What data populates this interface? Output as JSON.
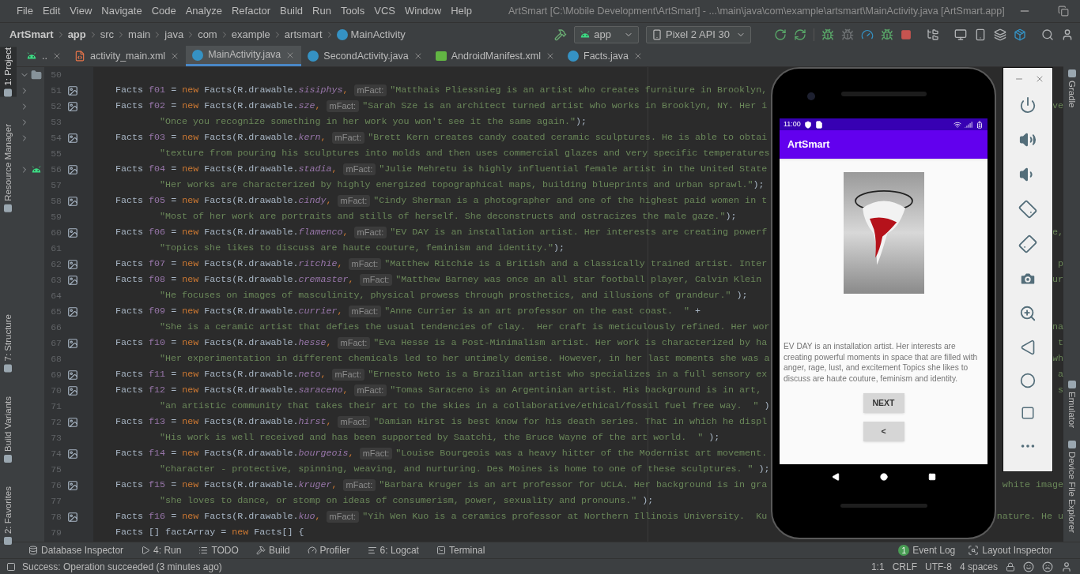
{
  "menu_bar": {
    "items": [
      "File",
      "Edit",
      "View",
      "Navigate",
      "Code",
      "Analyze",
      "Refactor",
      "Build",
      "Run",
      "Tools",
      "VCS",
      "Window",
      "Help"
    ],
    "title": "ArtSmart [C:\\Mobile Development\\ArtSmart] - ...\\main\\java\\com\\example\\artsmart\\MainActivity.java [ArtSmart.app]"
  },
  "nav_bar": {
    "breadcrumbs": [
      {
        "label": "ArtSmart",
        "bold": true
      },
      {
        "label": "app",
        "bold": true
      },
      {
        "label": "src",
        "bold": false
      },
      {
        "label": "main",
        "bold": false
      },
      {
        "label": "java",
        "bold": false
      },
      {
        "label": "com",
        "bold": false
      },
      {
        "label": "example",
        "bold": false
      },
      {
        "label": "artsmart",
        "bold": false
      },
      {
        "label": "MainActivity",
        "bold": false,
        "kind": "class"
      }
    ],
    "run_config": "app",
    "device": "Pixel 2 API 30"
  },
  "left_strip": [
    {
      "label": "1: Project",
      "selected": true
    },
    {
      "label": "Resource Manager",
      "selected": false
    },
    {
      "label": "7: Structure",
      "selected": false
    },
    {
      "label": "Build Variants",
      "selected": false
    },
    {
      "label": "2: Favorites",
      "selected": false
    }
  ],
  "right_strip": [
    "Gradle",
    "Emulator",
    "Device File Explorer"
  ],
  "tabs": [
    {
      "label": "..",
      "kind": "android",
      "selected": false
    },
    {
      "label": "activity_main.xml",
      "kind": "xml",
      "selected": false
    },
    {
      "label": "MainActivity.java",
      "kind": "class",
      "selected": true
    },
    {
      "label": "SecondActivity.java",
      "kind": "class",
      "selected": false
    },
    {
      "label": "AndroidManifest.xml",
      "kind": "manifest",
      "selected": false
    },
    {
      "label": "Facts.java",
      "kind": "class",
      "selected": false
    }
  ],
  "project_tree": [
    {
      "kind": "folder",
      "expanded": true
    },
    {
      "kind": "node",
      "expanded": false
    },
    {
      "kind": "node",
      "expanded": false
    },
    {
      "kind": "node",
      "expanded": false
    },
    {
      "kind": "node",
      "expanded": false
    },
    {
      "kind": "module",
      "expanded": false
    }
  ],
  "code_lines": [
    {
      "number": "50",
      "kind": "blank"
    },
    {
      "number": "51",
      "kind": "decl",
      "parts": [
        {
          "kind": "plain",
          "text": "Facts "
        },
        {
          "kind": "var",
          "text": "f01"
        },
        {
          "kind": "plain",
          "text": " = "
        },
        {
          "kind": "keyword",
          "text": "new"
        },
        {
          "kind": "plain",
          "text": " Facts(R.drawable."
        },
        {
          "kind": "field",
          "text": "sisiphys"
        },
        {
          "kind": "keyword",
          "text": ","
        }
      ],
      "hint": "mFact:",
      "after": [
        {
          "kind": "string",
          "text": "\"Matthais Pliessnieg is an artist who creates furniture in Brooklyn,"
        }
      ]
    },
    {
      "number": "52",
      "kind": "decl",
      "parts": [
        {
          "kind": "plain",
          "text": "Facts "
        },
        {
          "kind": "var",
          "text": "f02"
        },
        {
          "kind": "plain",
          "text": " = "
        },
        {
          "kind": "keyword",
          "text": "new"
        },
        {
          "kind": "plain",
          "text": " Facts(R.drawable."
        },
        {
          "kind": "field",
          "text": "sze"
        },
        {
          "kind": "keyword",
          "text": ","
        }
      ],
      "hint": "mFact:",
      "after": [
        {
          "kind": "string",
          "text": "\"Sarah Sze is an architect turned artist who works in Brooklyn, NY. Her i"
        }
      ],
      "tail": "ve"
    },
    {
      "number": "53",
      "kind": "continuation",
      "parts": [
        {
          "kind": "string",
          "text": "\"Once you recognize something in her work you won't see it the same again.\""
        },
        {
          "kind": "plain",
          "text": ");"
        }
      ]
    },
    {
      "number": "54",
      "kind": "decl",
      "parts": [
        {
          "kind": "plain",
          "text": "Facts "
        },
        {
          "kind": "var",
          "text": "f03"
        },
        {
          "kind": "plain",
          "text": " = "
        },
        {
          "kind": "keyword",
          "text": "new"
        },
        {
          "kind": "plain",
          "text": " Facts(R.drawable."
        },
        {
          "kind": "field",
          "text": "kern"
        },
        {
          "kind": "keyword",
          "text": ","
        }
      ],
      "hint": "mFact:",
      "after": [
        {
          "kind": "string",
          "text": "\"Brett Kern creates candy coated ceramic sculptures. He is able to obtai"
        }
      ]
    },
    {
      "number": "55",
      "kind": "continuation",
      "parts": [
        {
          "kind": "string",
          "text": "\"texture from pouring his sculptures into molds and then uses commercial glazes and very specific temperatures"
        }
      ]
    },
    {
      "number": "56",
      "kind": "decl",
      "parts": [
        {
          "kind": "plain",
          "text": "Facts "
        },
        {
          "kind": "var",
          "text": "f04"
        },
        {
          "kind": "plain",
          "text": " = "
        },
        {
          "kind": "keyword",
          "text": "new"
        },
        {
          "kind": "plain",
          "text": " Facts(R.drawable."
        },
        {
          "kind": "field",
          "text": "stadia"
        },
        {
          "kind": "keyword",
          "text": ","
        }
      ],
      "hint": "mFact:",
      "after": [
        {
          "kind": "string",
          "text": "\"Julie Mehretu is highly influential female artist in the United State"
        }
      ]
    },
    {
      "number": "57",
      "kind": "continuation",
      "parts": [
        {
          "kind": "string",
          "text": "\"Her works are characterized by highly energized topographical maps, building blueprints and urban sprawl.\""
        },
        {
          "kind": "plain",
          "text": ");"
        }
      ]
    },
    {
      "number": "58",
      "kind": "decl",
      "parts": [
        {
          "kind": "plain",
          "text": "Facts "
        },
        {
          "kind": "var",
          "text": "f05"
        },
        {
          "kind": "plain",
          "text": " = "
        },
        {
          "kind": "keyword",
          "text": "new"
        },
        {
          "kind": "plain",
          "text": " Facts(R.drawable."
        },
        {
          "kind": "field",
          "text": "cindy"
        },
        {
          "kind": "keyword",
          "text": ","
        }
      ],
      "hint": "mFact:",
      "after": [
        {
          "kind": "string",
          "text": "\"Cindy Sherman is a photographer and one of the highest paid women in t"
        }
      ]
    },
    {
      "number": "59",
      "kind": "continuation",
      "parts": [
        {
          "kind": "string",
          "text": "\"Most of her work are portraits and stills of herself. She deconstructs and ostracizes the male gaze.\""
        },
        {
          "kind": "plain",
          "text": ");"
        }
      ]
    },
    {
      "number": "60",
      "kind": "decl",
      "parts": [
        {
          "kind": "plain",
          "text": "Facts "
        },
        {
          "kind": "var",
          "text": "f06"
        },
        {
          "kind": "plain",
          "text": " = "
        },
        {
          "kind": "keyword",
          "text": "new"
        },
        {
          "kind": "plain",
          "text": " Facts(R.drawable."
        },
        {
          "kind": "field",
          "text": "flamenco"
        },
        {
          "kind": "keyword",
          "text": ","
        }
      ],
      "hint": "mFact:",
      "after": [
        {
          "kind": "string",
          "text": "\"EV DAY is an installation artist. Her interests are creating powerf"
        }
      ],
      "tail": "e,"
    },
    {
      "number": "61",
      "kind": "continuation",
      "parts": [
        {
          "kind": "string",
          "text": "\"Topics she likes to discuss are haute couture, feminism and identity.\""
        },
        {
          "kind": "plain",
          "text": ");"
        }
      ]
    },
    {
      "number": "62",
      "kind": "decl",
      "parts": [
        {
          "kind": "plain",
          "text": "Facts "
        },
        {
          "kind": "var",
          "text": "f07"
        },
        {
          "kind": "plain",
          "text": " = "
        },
        {
          "kind": "keyword",
          "text": "new"
        },
        {
          "kind": "plain",
          "text": " Facts(R.drawable."
        },
        {
          "kind": "field",
          "text": "ritchie"
        },
        {
          "kind": "keyword",
          "text": ","
        }
      ],
      "hint": "mFact:",
      "after": [
        {
          "kind": "string",
          "text": "\"Matthew Ritchie is a British and a classically trained artist. Inter"
        }
      ],
      "tail": "p"
    },
    {
      "number": "63",
      "kind": "decl",
      "parts": [
        {
          "kind": "plain",
          "text": "Facts "
        },
        {
          "kind": "var",
          "text": "f08"
        },
        {
          "kind": "plain",
          "text": " = "
        },
        {
          "kind": "keyword",
          "text": "new"
        },
        {
          "kind": "plain",
          "text": " Facts(R.drawable."
        },
        {
          "kind": "field",
          "text": "cremaster"
        },
        {
          "kind": "keyword",
          "text": ","
        }
      ],
      "hint": "mFact:",
      "after": [
        {
          "kind": "string",
          "text": "\"Matthew Barney was once an all star football player, Calvin Klein"
        }
      ],
      "tail": "ur"
    },
    {
      "number": "64",
      "kind": "continuation",
      "parts": [
        {
          "kind": "string",
          "text": "\"He focuses on images of masculinity, physical prowess through prosthetics, and illusions of grandeur.\""
        },
        {
          "kind": "plain",
          "text": " );"
        }
      ]
    },
    {
      "number": "65",
      "kind": "decl",
      "parts": [
        {
          "kind": "plain",
          "text": "Facts "
        },
        {
          "kind": "var",
          "text": "f09"
        },
        {
          "kind": "plain",
          "text": " = "
        },
        {
          "kind": "keyword",
          "text": "new"
        },
        {
          "kind": "plain",
          "text": " Facts(R.drawable."
        },
        {
          "kind": "field",
          "text": "currier"
        },
        {
          "kind": "keyword",
          "text": ","
        }
      ],
      "hint": "mFact:",
      "after": [
        {
          "kind": "string",
          "text": "\"Anne Currier is an art professor on the east coast.  \""
        },
        {
          "kind": "plain",
          "text": " +"
        }
      ]
    },
    {
      "number": "66",
      "kind": "continuation",
      "parts": [
        {
          "kind": "string",
          "text": "\"She is a ceramic artist that defies the usual tendencies of clay.  Her craft is meticulously refined. Her wor"
        }
      ],
      "tail": "na"
    },
    {
      "number": "67",
      "kind": "decl",
      "parts": [
        {
          "kind": "plain",
          "text": "Facts "
        },
        {
          "kind": "var",
          "text": "f10"
        },
        {
          "kind": "plain",
          "text": " = "
        },
        {
          "kind": "keyword",
          "text": "new"
        },
        {
          "kind": "plain",
          "text": " Facts(R.drawable."
        },
        {
          "kind": "field",
          "text": "hesse"
        },
        {
          "kind": "keyword",
          "text": ","
        }
      ],
      "hint": "mFact:",
      "after": [
        {
          "kind": "string",
          "text": "\"Eva Hesse is a Post-Minimalism artist. Her work is characterized by ha"
        }
      ],
      "tail": "t"
    },
    {
      "number": "68",
      "kind": "continuation",
      "parts": [
        {
          "kind": "string",
          "text": "\"Her experimentation in different chemicals led to her untimely demise. However, in her last moments she was a"
        }
      ],
      "tail": "wh"
    },
    {
      "number": "69",
      "kind": "decl",
      "parts": [
        {
          "kind": "plain",
          "text": "Facts "
        },
        {
          "kind": "var",
          "text": "f11"
        },
        {
          "kind": "plain",
          "text": " = "
        },
        {
          "kind": "keyword",
          "text": "new"
        },
        {
          "kind": "plain",
          "text": " Facts(R.drawable."
        },
        {
          "kind": "field",
          "text": "neto"
        },
        {
          "kind": "keyword",
          "text": ","
        }
      ],
      "hint": "mFact:",
      "after": [
        {
          "kind": "string",
          "text": "\"Ernesto Neto is a Brazilian artist who specializes in a full sensory ex"
        }
      ],
      "tail": "a"
    },
    {
      "number": "70",
      "kind": "decl",
      "parts": [
        {
          "kind": "plain",
          "text": "Facts "
        },
        {
          "kind": "var",
          "text": "f12"
        },
        {
          "kind": "plain",
          "text": " = "
        },
        {
          "kind": "keyword",
          "text": "new"
        },
        {
          "kind": "plain",
          "text": " Facts(R.drawable."
        },
        {
          "kind": "field",
          "text": "saraceno"
        },
        {
          "kind": "keyword",
          "text": ","
        }
      ],
      "hint": "mFact:",
      "after": [
        {
          "kind": "string",
          "text": "\"Tomas Saraceno is an Argentinian artist. His background is in art,"
        }
      ],
      "tail": "s"
    },
    {
      "number": "71",
      "kind": "continuation",
      "parts": [
        {
          "kind": "string",
          "text": "\"an artistic community that takes their art to the skies in a collaborative/ethical/fossil fuel free way.  \""
        },
        {
          "kind": "plain",
          "text": " )"
        }
      ]
    },
    {
      "number": "72",
      "kind": "decl",
      "parts": [
        {
          "kind": "plain",
          "text": "Facts "
        },
        {
          "kind": "var",
          "text": "f13"
        },
        {
          "kind": "plain",
          "text": " = "
        },
        {
          "kind": "keyword",
          "text": "new"
        },
        {
          "kind": "plain",
          "text": " Facts(R.drawable."
        },
        {
          "kind": "field",
          "text": "hirst"
        },
        {
          "kind": "keyword",
          "text": ","
        }
      ],
      "hint": "mFact:",
      "after": [
        {
          "kind": "string",
          "text": "\"Damian Hirst is best know for his death series. That in which he displ"
        }
      ]
    },
    {
      "number": "73",
      "kind": "continuation",
      "parts": [
        {
          "kind": "string",
          "text": "\"His work is well received and has been supported by Saatchi, the Bruce Wayne of the art world.  \""
        },
        {
          "kind": "plain",
          "text": " );"
        }
      ]
    },
    {
      "number": "74",
      "kind": "decl",
      "parts": [
        {
          "kind": "plain",
          "text": "Facts "
        },
        {
          "kind": "var",
          "text": "f14"
        },
        {
          "kind": "plain",
          "text": " = "
        },
        {
          "kind": "keyword",
          "text": "new"
        },
        {
          "kind": "plain",
          "text": " Facts(R.drawable."
        },
        {
          "kind": "field",
          "text": "bourgeois"
        },
        {
          "kind": "keyword",
          "text": ","
        }
      ],
      "hint": "mFact:",
      "after": [
        {
          "kind": "string",
          "text": "\"Louise Bourgeois was a heavy hitter of the Modernist art movement."
        }
      ]
    },
    {
      "number": "75",
      "kind": "continuation",
      "parts": [
        {
          "kind": "string",
          "text": "\"character - protective, spinning, weaving, and nurturing. Des Moines is home to one of these sculptures. \""
        },
        {
          "kind": "plain",
          "text": " );"
        }
      ]
    },
    {
      "number": "76",
      "kind": "decl",
      "parts": [
        {
          "kind": "plain",
          "text": "Facts "
        },
        {
          "kind": "var",
          "text": "f15"
        },
        {
          "kind": "plain",
          "text": " = "
        },
        {
          "kind": "keyword",
          "text": "new"
        },
        {
          "kind": "plain",
          "text": " Facts(R.drawable."
        },
        {
          "kind": "field",
          "text": "kruger"
        },
        {
          "kind": "keyword",
          "text": ","
        }
      ],
      "hint": "mFact:",
      "after": [
        {
          "kind": "string",
          "text": "\"Barbara Kruger is an art professor for UCLA. Her background is in gra"
        }
      ],
      "tail": "white image"
    },
    {
      "number": "77",
      "kind": "continuation",
      "parts": [
        {
          "kind": "string",
          "text": "\"she loves to dance, or stomp on ideas of consumerism, power, sexuality and pronouns.\""
        },
        {
          "kind": "plain",
          "text": " );"
        }
      ]
    },
    {
      "number": "78",
      "kind": "decl",
      "parts": [
        {
          "kind": "plain",
          "text": "Facts "
        },
        {
          "kind": "var",
          "text": "f16"
        },
        {
          "kind": "plain",
          "text": " = "
        },
        {
          "kind": "keyword",
          "text": "new"
        },
        {
          "kind": "plain",
          "text": " Facts(R.drawable."
        },
        {
          "kind": "field",
          "text": "kuo"
        },
        {
          "kind": "keyword",
          "text": ","
        }
      ],
      "hint": "mFact:",
      "after": [
        {
          "kind": "string",
          "text": "\"Yih Wen Kuo is a ceramics professor at Northern Illinois University.  Ku"
        }
      ],
      "tail": "nature. He u"
    },
    {
      "number": "79",
      "kind": "statement",
      "parts": [
        {
          "kind": "plain",
          "text": "Facts [] factArray = "
        },
        {
          "kind": "keyword",
          "text": "new"
        },
        {
          "kind": "plain",
          "text": " Facts[] {"
        }
      ]
    }
  ],
  "emulator": {
    "time": "11:00",
    "app_title": "ArtSmart",
    "description": "EV DAY is an installation artist. Her interests are creating powerful moments in space that are filled with anger, rage, lust, and excitement Topics she likes to discuss are haute couture, feminism and identity.",
    "buttons": [
      "NEXT",
      "<"
    ]
  },
  "tool_windows": {
    "left": [
      {
        "label": "Database Inspector",
        "kind": "database"
      },
      {
        "label": "4: Run",
        "kind": "run"
      },
      {
        "label": "TODO",
        "kind": "todo"
      },
      {
        "label": "Build",
        "kind": "build"
      },
      {
        "label": "Profiler",
        "kind": "profiler"
      },
      {
        "label": "6: Logcat",
        "kind": "logcat"
      },
      {
        "label": "Terminal",
        "kind": "terminal"
      }
    ],
    "event_log": {
      "count": "1",
      "label": "Event Log"
    },
    "layout_inspector": "Layout Inspector"
  },
  "status_bar": {
    "message": "Success: Operation succeeded (3 minutes ago)",
    "items": [
      "1:1",
      "CRLF",
      "UTF-8",
      "4 spaces"
    ]
  }
}
